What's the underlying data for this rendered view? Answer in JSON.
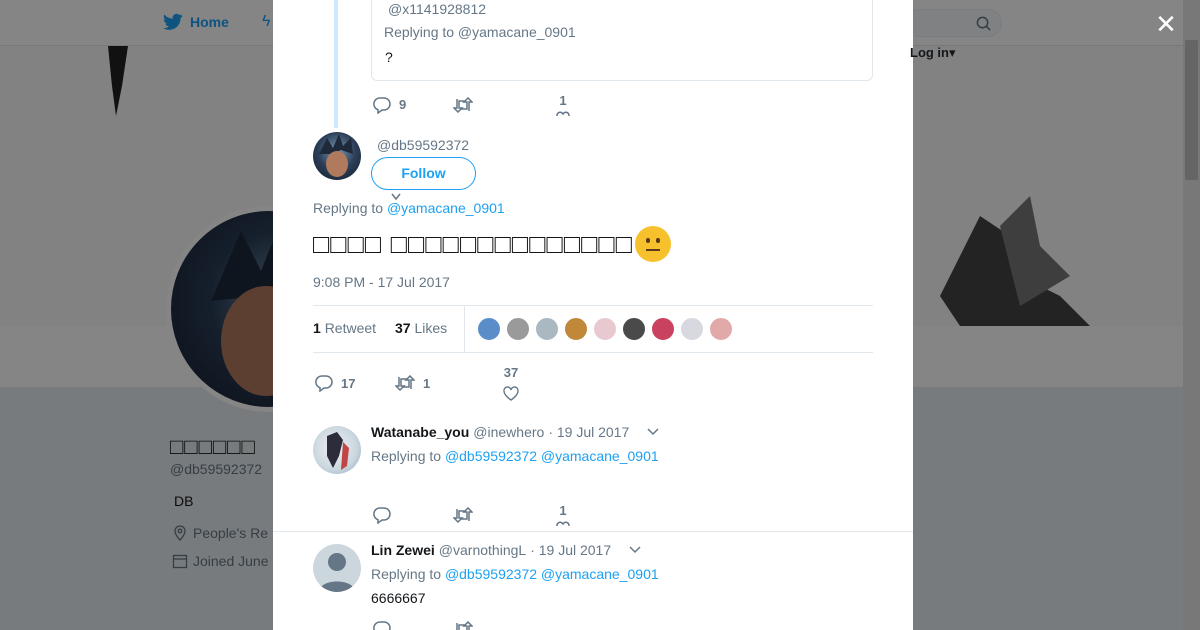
{
  "topbar": {
    "home_label": "Home",
    "login_label": "Log in"
  },
  "profile": {
    "name": "□□□□□□",
    "handle": "@db59592372",
    "bio": "DB",
    "location": "People's Re",
    "joined": "Joined June"
  },
  "modal": {
    "close_glyph": "✕",
    "quoted": {
      "handle": "@x1141928812",
      "replying": "Replying to @yamacane_0901",
      "text": "?",
      "reply_count": "9",
      "like_count": "1"
    },
    "tweet": {
      "handle": "@db59592372",
      "follow_label": "Follow",
      "replying_prefix": "Replying to ",
      "replying_to": "@yamacane_0901",
      "text": "□□□□ □□□□□□□□□□□□□□",
      "timestamp": "9:08 PM - 17 Jul 2017",
      "retweets_count": "1",
      "retweets_label": "Retweet",
      "likes_count": "37",
      "likes_label": "Likes",
      "reply_count": "17",
      "retweet_count": "1",
      "like_count": "37"
    },
    "replies": [
      {
        "name": "Watanabe_you",
        "handle": "@inewhero",
        "date": "· 19 Jul 2017",
        "replying_prefix": "Replying to",
        "replying_to": "@db59592372 @yamacane_0901",
        "text": "",
        "like_count": "1"
      },
      {
        "name": "Lin Zewei",
        "handle": "@varnothingL",
        "date": "· 19 Jul 2017",
        "replying_prefix": "Replying to",
        "replying_to": "@db59592372 @yamacane_0901",
        "text": "6666667",
        "like_count": ""
      }
    ]
  },
  "colors": {
    "accent": "#1da1f2",
    "muted": "#657786",
    "text": "#14171a",
    "border": "#e1e8ed"
  },
  "liker_colors": [
    "#5b8ec9",
    "#9a9a9a",
    "#aab8c2",
    "#c2883a",
    "#e8c9d0",
    "#4a4a4a",
    "#c9425f",
    "#d8d8e0",
    "#e2a9a9"
  ]
}
